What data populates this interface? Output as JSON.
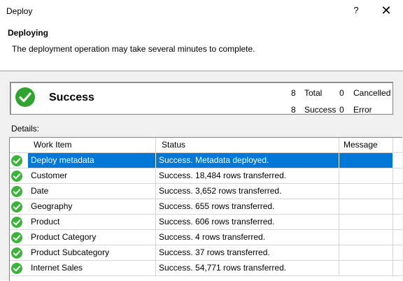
{
  "window": {
    "title": "Deploy",
    "help_label": "?",
    "close_label": "✕"
  },
  "header": {
    "heading": "Deploying",
    "subheading": "The deployment operation may take several minutes to complete."
  },
  "summary": {
    "status": "Success",
    "total_count": "8",
    "total_label": "Total",
    "cancelled_count": "0",
    "cancelled_label": "Cancelled",
    "success_count": "8",
    "success_label": "Success",
    "error_count": "0",
    "error_label": "Error"
  },
  "details": {
    "label": "Details:",
    "columns": {
      "work_item": "Work Item",
      "status": "Status",
      "message": "Message"
    },
    "rows": [
      {
        "work_item": "Deploy metadata",
        "status": "Success. Metadata deployed.",
        "message": "",
        "selected": true
      },
      {
        "work_item": "Customer",
        "status": "Success. 18,484 rows transferred.",
        "message": ""
      },
      {
        "work_item": "Date",
        "status": "Success. 3,652 rows transferred.",
        "message": ""
      },
      {
        "work_item": "Geography",
        "status": "Success. 655 rows transferred.",
        "message": ""
      },
      {
        "work_item": "Product",
        "status": "Success. 606 rows transferred.",
        "message": ""
      },
      {
        "work_item": "Product Category",
        "status": "Success. 4 rows transferred.",
        "message": ""
      },
      {
        "work_item": "Product Subcategory",
        "status": "Success. 37 rows transferred.",
        "message": ""
      },
      {
        "work_item": "Internet Sales",
        "status": "Success. 54,771 rows transferred.",
        "message": ""
      }
    ]
  },
  "colors": {
    "success_green": "#3cb43c",
    "selection_blue": "#0078d7"
  },
  "icons": {
    "status": "check-circle-icon"
  }
}
